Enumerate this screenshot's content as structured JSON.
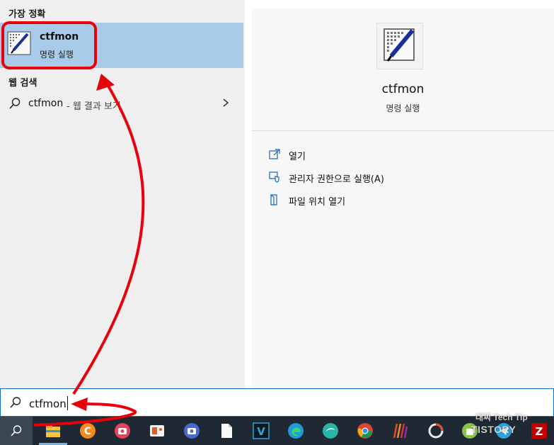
{
  "left_pane": {
    "best_match_heading": "가장 정확",
    "best_match": {
      "title": "ctfmon",
      "subtitle": "명령 실행"
    },
    "web_heading": "웹 검색",
    "web_result": {
      "query": "ctfmon",
      "suffix": "- 웹 결과 보기"
    }
  },
  "right_pane": {
    "title": "ctfmon",
    "subtitle": "명령 실행",
    "actions": [
      {
        "label": "열기",
        "icon": "open-icon"
      },
      {
        "label": "관리자 권한으로 실행(A)",
        "icon": "shield-icon"
      },
      {
        "label": "파일 위치 열기",
        "icon": "file-location-icon"
      }
    ]
  },
  "search": {
    "value": "ctfmon"
  },
  "taskbar": {
    "apps": [
      "file-explorer",
      "ccleaner",
      "screen-recorder",
      "photo-app",
      "camera-app",
      "notepad",
      "v-app",
      "edge",
      "app-swirl",
      "chrome",
      "stripes-app",
      "loading-app",
      "android-app",
      "telegram",
      "filezilla"
    ]
  },
  "watermark": {
    "line1": "대찌 Tech Tip",
    "line2": "TISTORY"
  },
  "colors": {
    "selection": "#a9cbe9",
    "accent": "#0f6fc6",
    "annotation": "#e8000a",
    "taskbar": "#1f2933"
  }
}
